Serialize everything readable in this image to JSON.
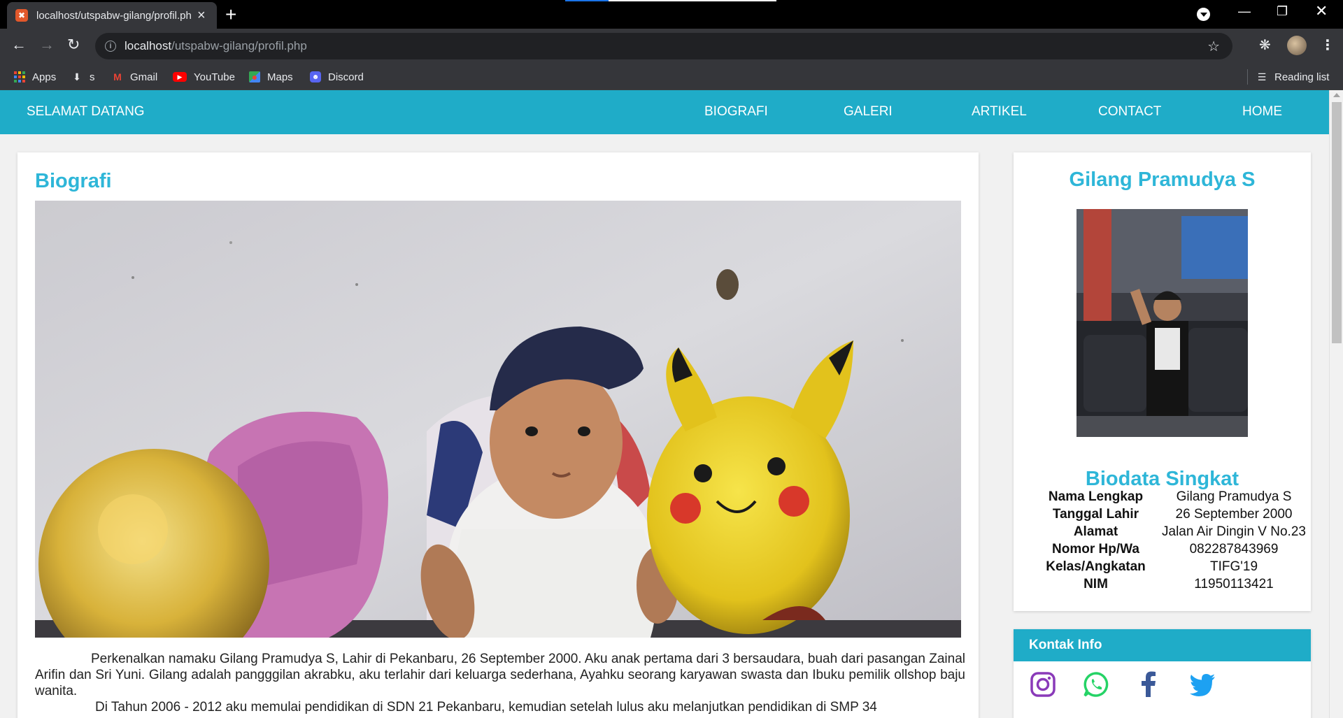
{
  "browser": {
    "tab_title": "localhost/utspabw-gilang/profil.php",
    "url_host": "localhost",
    "url_path": "/utspabw-gilang/profil.php",
    "bookmarks": [
      {
        "label": "Apps",
        "icon": "apps-grid-icon"
      },
      {
        "label": "s",
        "icon": "download-icon"
      },
      {
        "label": "Gmail",
        "icon": "gmail-icon"
      },
      {
        "label": "YouTube",
        "icon": "youtube-icon"
      },
      {
        "label": "Maps",
        "icon": "maps-icon"
      },
      {
        "label": "Discord",
        "icon": "discord-icon"
      }
    ],
    "reading_list": "Reading list"
  },
  "nav": {
    "brand": "SELAMAT DATANG",
    "links": [
      "BIOGRAFI",
      "GALERI",
      "ARTIKEL",
      "CONTACT",
      "HOME"
    ]
  },
  "main": {
    "heading": "Biografi",
    "paragraph_1": "Perkenalkan namaku Gilang Pramudya S, Lahir di Pekanbaru, 26 September 2000. Aku anak pertama dari 3 bersaudara, buah dari pasangan Zainal Arifin dan Sri Yuni. Gilang adalah pangggilan akrabku, aku terlahir dari keluarga sederhana, Ayahku seorang karyawan swasta dan Ibuku pemilik ollshop baju wanita.",
    "paragraph_2": "Di Tahun 2006 - 2012 aku memulai pendidikan di SDN 21 Pekanbaru, kemudian setelah lulus aku melanjutkan pendidikan di SMP 34"
  },
  "profile": {
    "name": "Gilang Pramudya S",
    "bio_title": "Biodata Singkat",
    "rows": [
      {
        "label": "Nama Lengkap",
        "value": "Gilang Pramudya S"
      },
      {
        "label": "Tanggal Lahir",
        "value": "26 September 2000"
      },
      {
        "label": "Alamat",
        "value": "Jalan Air Dingin V No.23"
      },
      {
        "label": "Nomor Hp/Wa",
        "value": "082287843969"
      },
      {
        "label": "Kelas/Angkatan",
        "value": "TIFG'19"
      },
      {
        "label": "NIM",
        "value": "11950113421"
      }
    ]
  },
  "contact": {
    "heading": "Kontak Info",
    "icons": [
      "instagram-icon",
      "whatsapp-icon",
      "facebook-icon",
      "twitter-icon"
    ]
  },
  "colors": {
    "accent": "#1facc8",
    "heading": "#2eb6d8",
    "instagram": "#8a3ab9",
    "whatsapp": "#25d366",
    "facebook": "#3b5998",
    "twitter": "#1da1f2"
  }
}
